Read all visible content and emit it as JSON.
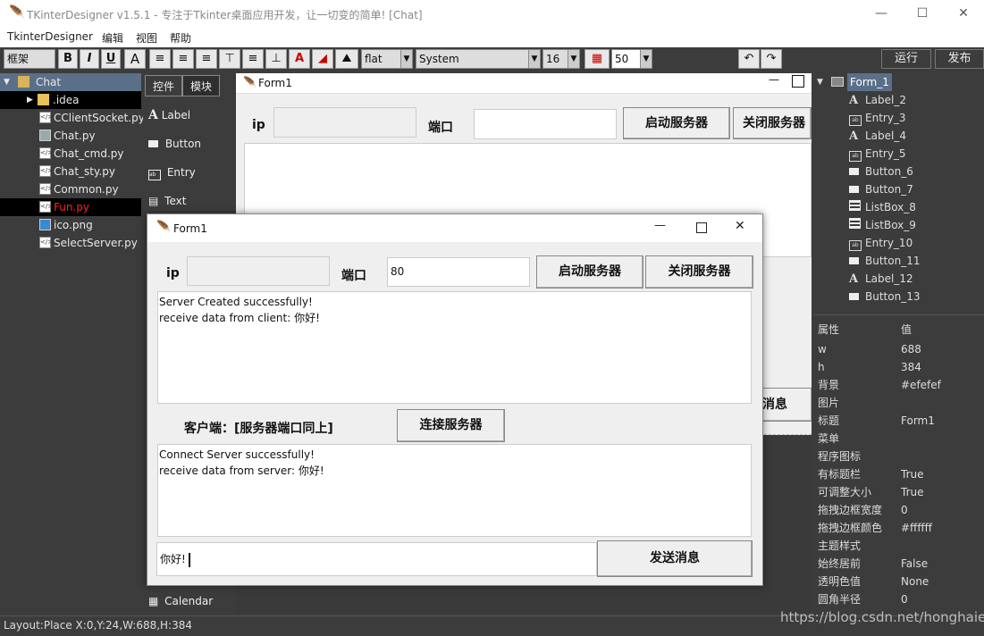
{
  "app": {
    "title": "TKinterDesigner v1.5.1 - 专注于Tkinter桌面应用开发，让一切变的简单!    [Chat]"
  },
  "menu": [
    "TkinterDesigner",
    "编辑",
    "视图",
    "帮助"
  ],
  "toolbar": {
    "frame_select": "框架",
    "bold": "B",
    "italic": "I",
    "underline": "U",
    "font_a": "A",
    "relief": "flat",
    "font_family": "System",
    "font_size": "16",
    "grid_value": "50",
    "run": "运行",
    "publish": "发布"
  },
  "filetree": {
    "items": [
      {
        "label": "Chat",
        "type": "project"
      },
      {
        "label": ".idea",
        "type": "folder"
      },
      {
        "label": "CClientSocket.py",
        "type": "py"
      },
      {
        "label": "Chat.py",
        "type": "form"
      },
      {
        "label": "Chat_cmd.py",
        "type": "py"
      },
      {
        "label": "Chat_sty.py",
        "type": "py"
      },
      {
        "label": "Common.py",
        "type": "py"
      },
      {
        "label": "Fun.py",
        "type": "py"
      },
      {
        "label": "ico.png",
        "type": "image"
      },
      {
        "label": "SelectServer.py",
        "type": "py"
      }
    ]
  },
  "palette": {
    "tabs": [
      "控件",
      "模块"
    ],
    "items": [
      "Label",
      "Button",
      "Entry",
      "Text",
      "Calendar"
    ]
  },
  "design_form": {
    "title": "Form1",
    "ip_label": "ip",
    "port_label": "端口",
    "start_button": "启动服务器",
    "stop_button": "关闭服务器",
    "send_fragment": "消息"
  },
  "running_form": {
    "title": "Form1",
    "ip_label": "ip",
    "port_label": "端口",
    "port_value": "80",
    "start_button": "启动服务器",
    "stop_button": "关闭服务器",
    "server_log": [
      "Server Created successfully!",
      "receive data from client:   你好!"
    ],
    "client_label": "客户端：[服务器端口同上]",
    "connect_button": "连接服务器",
    "client_log": [
      "Connect Server successfully!",
      "receive data from server:   你好!"
    ],
    "message_value": "你好!",
    "send_button": "发送消息"
  },
  "component_tree": {
    "root": "Form_1",
    "items": [
      {
        "label": "Label_2",
        "type": "label"
      },
      {
        "label": "Entry_3",
        "type": "entry"
      },
      {
        "label": "Label_4",
        "type": "label"
      },
      {
        "label": "Entry_5",
        "type": "entry"
      },
      {
        "label": "Button_6",
        "type": "button"
      },
      {
        "label": "Button_7",
        "type": "button"
      },
      {
        "label": "ListBox_8",
        "type": "listbox"
      },
      {
        "label": "ListBox_9",
        "type": "listbox"
      },
      {
        "label": "Entry_10",
        "type": "entry"
      },
      {
        "label": "Button_11",
        "type": "button"
      },
      {
        "label": "Label_12",
        "type": "label"
      },
      {
        "label": "Button_13",
        "type": "button"
      }
    ]
  },
  "properties": {
    "header": [
      "属性",
      "值"
    ],
    "rows": [
      [
        "w",
        "688"
      ],
      [
        "h",
        "384"
      ],
      [
        "背景",
        "#efefef"
      ],
      [
        "图片",
        ""
      ],
      [
        "标题",
        "Form1"
      ],
      [
        "菜单",
        ""
      ],
      [
        "程序图标",
        ""
      ],
      [
        "有标题栏",
        "True"
      ],
      [
        "可调整大小",
        "True"
      ],
      [
        "拖拽边框宽度",
        "0"
      ],
      [
        "拖拽边框颜色",
        "#ffffff"
      ],
      [
        "主题样式",
        ""
      ],
      [
        "始终居前",
        "False"
      ],
      [
        "透明色值",
        "None"
      ],
      [
        "圆角半径",
        "0"
      ]
    ]
  },
  "status": {
    "text": "Layout:Place  X:0,Y:24,W:688,H:384",
    "watermark": "https://blog.csdn.net/honghaier"
  }
}
